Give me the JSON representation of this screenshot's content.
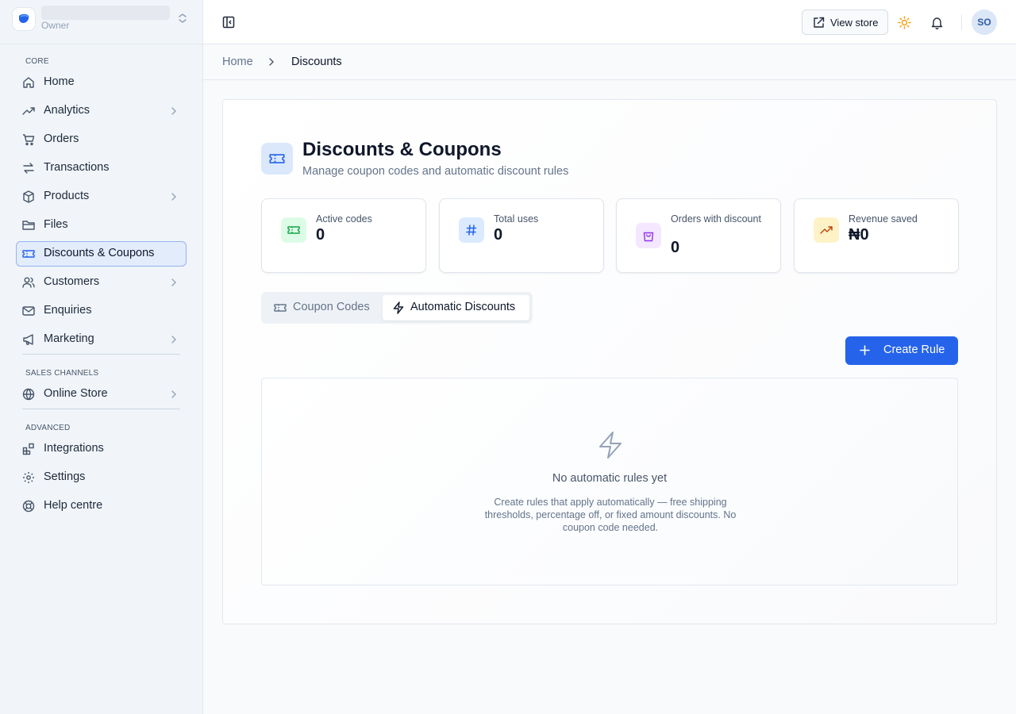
{
  "store": {
    "role": "Owner"
  },
  "sidebar": {
    "sections": {
      "core": "CORE",
      "sales_channels": "SALES CHANNELS",
      "advanced": "ADVANCED"
    },
    "items": [
      {
        "label": "Home",
        "icon": "home-icon"
      },
      {
        "label": "Analytics",
        "icon": "trending-up-icon",
        "expandable": true
      },
      {
        "label": "Orders",
        "icon": "cart-icon"
      },
      {
        "label": "Transactions",
        "icon": "transfer-icon"
      },
      {
        "label": "Products",
        "icon": "box-icon",
        "expandable": true
      },
      {
        "label": "Files",
        "icon": "folder-icon"
      },
      {
        "label": "Discounts & Coupons",
        "icon": "ticket-icon",
        "active": true
      },
      {
        "label": "Customers",
        "icon": "users-icon",
        "expandable": true
      },
      {
        "label": "Enquiries",
        "icon": "mail-icon"
      },
      {
        "label": "Marketing",
        "icon": "megaphone-icon",
        "expandable": true
      },
      {
        "label": "Online Store",
        "icon": "globe-icon",
        "expandable": true
      },
      {
        "label": "Integrations",
        "icon": "blocks-icon"
      },
      {
        "label": "Settings",
        "icon": "gear-icon"
      },
      {
        "label": "Help centre",
        "icon": "lifebuoy-icon"
      }
    ]
  },
  "topbar": {
    "view_store_label": "View store",
    "avatar_initials": "SO"
  },
  "breadcrumb": {
    "home": "Home",
    "current": "Discounts"
  },
  "page": {
    "title": "Discounts & Coupons",
    "subtitle": "Manage coupon codes and automatic discount rules"
  },
  "stats": [
    {
      "label": "Active codes",
      "value": "0",
      "icon": "ticket-icon",
      "color": "#16a34a",
      "bg": "#dcfce7"
    },
    {
      "label": "Total uses",
      "value": "0",
      "icon": "hash-icon",
      "color": "#2563eb",
      "bg": "#dbeafe"
    },
    {
      "label": "Orders with discount",
      "value": "0",
      "icon": "shopping-bag-icon",
      "color": "#9333ea",
      "bg": "#f3e8ff"
    },
    {
      "label": "Revenue saved",
      "value": "₦0",
      "icon": "trending-up-icon",
      "color": "#c2410c",
      "bg": "#fef3c7"
    }
  ],
  "tabs": [
    {
      "label": "Coupon Codes",
      "icon": "ticket-icon",
      "active": false
    },
    {
      "label": "Automatic Discounts",
      "icon": "zap-icon",
      "active": true
    }
  ],
  "actions": {
    "create_rule_label": "Create Rule"
  },
  "empty_state": {
    "title": "No automatic rules yet",
    "description": "Create rules that apply automatically — free shipping thresholds, percentage off, or fixed amount discounts. No coupon code needed."
  },
  "colors": {
    "accent": "#2563eb",
    "active_nav_bg": "#e3ecfb",
    "active_nav_border": "#93b4f3"
  }
}
